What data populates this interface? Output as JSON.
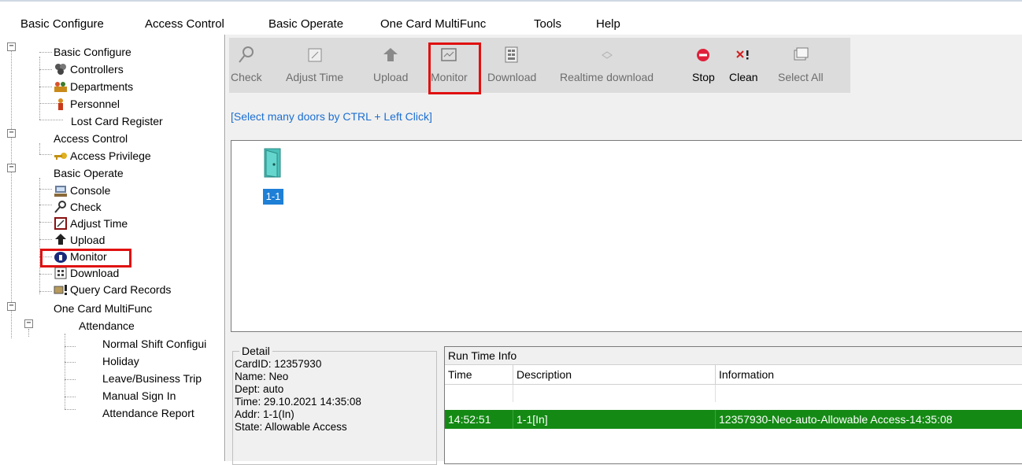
{
  "menu": {
    "items": [
      "Basic Configure",
      "Access Control",
      "Basic Operate",
      "One Card MultiFunc",
      "Tools",
      "Help"
    ]
  },
  "tree": {
    "nodes": [
      {
        "label": "Basic Configure",
        "icon": "none"
      },
      {
        "label": "Controllers",
        "icon": "controllers-icon"
      },
      {
        "label": "Departments",
        "icon": "departments-icon"
      },
      {
        "label": "Personnel",
        "icon": "personnel-icon"
      },
      {
        "label": "Lost Card Register",
        "icon": "none"
      },
      {
        "label": "Access Control",
        "icon": "none"
      },
      {
        "label": "Access Privilege",
        "icon": "key-icon"
      },
      {
        "label": "Basic Operate",
        "icon": "none"
      },
      {
        "label": "Console",
        "icon": "console-icon"
      },
      {
        "label": "Check",
        "icon": "check-icon"
      },
      {
        "label": "Adjust Time",
        "icon": "adjust-time-icon"
      },
      {
        "label": "Upload",
        "icon": "upload-icon"
      },
      {
        "label": "Monitor",
        "icon": "monitor-icon"
      },
      {
        "label": "Download",
        "icon": "download-icon"
      },
      {
        "label": "Query Card Records",
        "icon": "query-icon"
      },
      {
        "label": "One Card MultiFunc",
        "icon": "none"
      },
      {
        "label": "Attendance",
        "icon": "none"
      },
      {
        "label": "Normal Shift Configui",
        "icon": "none"
      },
      {
        "label": "Holiday",
        "icon": "none"
      },
      {
        "label": "Leave/Business Trip",
        "icon": "none"
      },
      {
        "label": "Manual Sign In",
        "icon": "none"
      },
      {
        "label": "Attendance Report",
        "icon": "none"
      }
    ]
  },
  "toolbar": {
    "buttons": [
      {
        "label": "Check",
        "icon": "check-icon",
        "enabled": false
      },
      {
        "label": "Adjust Time",
        "icon": "adjust-time-icon",
        "enabled": false
      },
      {
        "label": "Upload",
        "icon": "upload-icon",
        "enabled": false
      },
      {
        "label": "Monitor",
        "icon": "monitor-icon",
        "enabled": false
      },
      {
        "label": "Download",
        "icon": "download-icon",
        "enabled": false
      },
      {
        "label": "Realtime download",
        "icon": "realtime-download-icon",
        "enabled": false
      },
      {
        "label": "Stop",
        "icon": "stop-icon",
        "enabled": true
      },
      {
        "label": "Clean",
        "icon": "clean-icon",
        "enabled": true
      },
      {
        "label": "Select All",
        "icon": "select-all-icon",
        "enabled": false
      }
    ]
  },
  "hint": "[Select many doors by CTRL + Left Click]",
  "doors": [
    {
      "label": "1-1",
      "icon": "door-icon"
    }
  ],
  "detail": {
    "legend": "Detail",
    "lines": [
      "CardID: 12357930",
      "Name: Neo",
      "Dept: auto",
      "Time: 29.10.2021 14:35:08",
      "Addr: 1-1(In)",
      "State: Allowable Access"
    ]
  },
  "runtime": {
    "title": "Run Time Info",
    "columns": [
      "Time",
      "Description",
      "Information"
    ],
    "rows": [
      {
        "time": "14:52:51",
        "description": "1-1[In]",
        "information": "12357930-Neo-auto-Allowable Access-14:35:08"
      }
    ]
  },
  "colors": {
    "highlight_box": "#e01010",
    "selected_row": "#148a14",
    "hint_text": "#1c6fd1",
    "door_label_bg": "#1e7fd6"
  }
}
